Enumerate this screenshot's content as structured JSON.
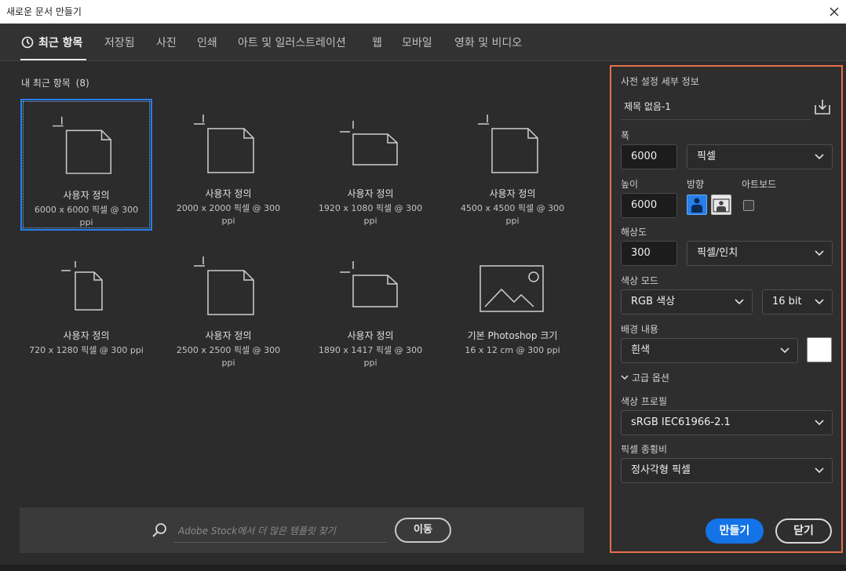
{
  "window": {
    "title": "새로운 문서 만들기"
  },
  "tabs": [
    {
      "label": "최근 항목"
    },
    {
      "label": "저장됨"
    },
    {
      "label": "사진"
    },
    {
      "label": "인쇄"
    },
    {
      "label": "아트 및 일러스트레이션"
    },
    {
      "label": "웹"
    },
    {
      "label": "모바일"
    },
    {
      "label": "영화 및 비디오"
    }
  ],
  "recent": {
    "heading": "내 최근 항목",
    "count": "(8)",
    "items": [
      {
        "name": "사용자 정의",
        "meta": "6000 x 6000 픽셀 @ 300 ppi"
      },
      {
        "name": "사용자 정의",
        "meta": "2000 x 2000 픽셀 @ 300 ppi"
      },
      {
        "name": "사용자 정의",
        "meta": "1920 x 1080 픽셀 @ 300 ppi"
      },
      {
        "name": "사용자 정의",
        "meta": "4500 x 4500 픽셀 @ 300 ppi"
      },
      {
        "name": "사용자 정의",
        "meta": "720 x 1280 픽셀 @ 300 ppi"
      },
      {
        "name": "사용자 정의",
        "meta": "2500 x 2500 픽셀 @ 300 ppi"
      },
      {
        "name": "사용자 정의",
        "meta": "1890 x 1417 픽셀 @ 300 ppi"
      },
      {
        "name": "기본 Photoshop 크기",
        "meta": "16 x 12 cm @ 300 ppi"
      }
    ]
  },
  "search": {
    "placeholder": "Adobe Stock에서 더 많은 템플릿 찾기",
    "go_label": "이동"
  },
  "preset": {
    "heading": "사전 설정 세부 정보",
    "doc_name": "제목 없음-1",
    "width_label": "폭",
    "width_value": "6000",
    "width_unit": "픽셀",
    "height_label": "높이",
    "height_value": "6000",
    "orientation_label": "방향",
    "artboard_label": "아트보드",
    "resolution_label": "해상도",
    "resolution_value": "300",
    "resolution_unit": "픽셀/인치",
    "color_mode_label": "색상 모드",
    "color_mode_value": "RGB 색상",
    "bit_depth": "16 bit",
    "background_label": "배경 내용",
    "background_value": "흰색",
    "background_color": "#ffffff",
    "advanced_label": "고급 옵션",
    "color_profile_label": "색상 프로필",
    "color_profile_value": "sRGB IEC61966-2.1",
    "pixel_aspect_label": "픽셀 종횡비",
    "pixel_aspect_value": "정사각형 픽셀",
    "create_label": "만들기",
    "close_label": "닫기"
  },
  "colors": {
    "accent": "#2680eb",
    "panel_border": "#e8704a",
    "create_button": "#1473e6"
  }
}
